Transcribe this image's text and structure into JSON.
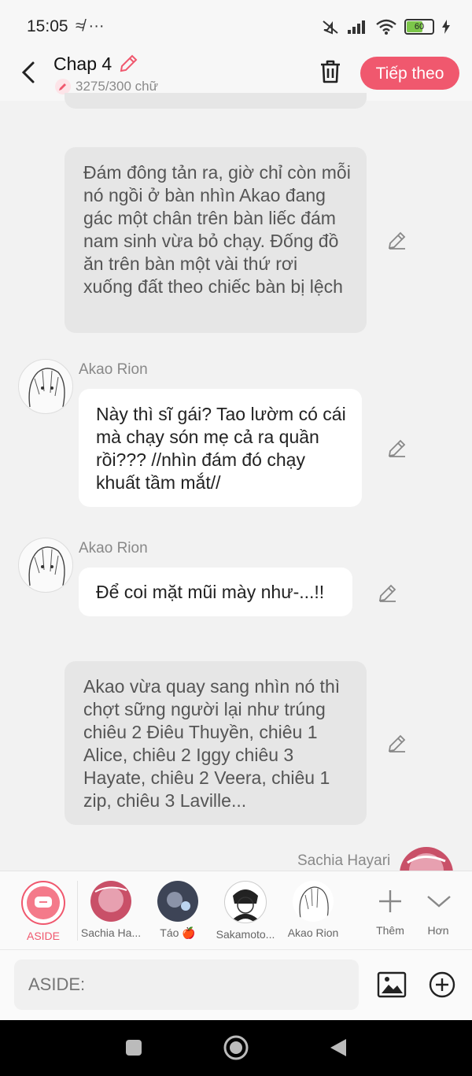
{
  "status": {
    "time": "15:05",
    "extra": "≉ ···",
    "battery": "60"
  },
  "header": {
    "title": "Chap 4",
    "word_count": "3275/300 chữ",
    "next_label": "Tiếp theo"
  },
  "messages": {
    "narr1": "Đám đông tản ra, giờ chỉ còn mỗi nó ngồi ở bàn nhìn Akao đang gác một chân trên bàn liếc đám nam sinh vừa bỏ chạy. Đống đồ ăn trên bàn một vài thứ rơi xuống đất theo chiếc bàn bị lệch",
    "m1_name": "Akao Rion",
    "m1_text": "Này thì sĩ gái? Tao lườm có cái mà chạy són mẹ cả ra quần rồi??? //nhìn đám đó chạy khuất tầm mắt//",
    "m2_name": "Akao Rion",
    "m2_text": "Để coi mặt mũi mày như-...!!",
    "narr2": "Akao vừa quay sang nhìn nó thì chợt sững người lại như trúng chiêu 2 Điêu Thuyền, chiêu 1 Alice, chiêu 2 Iggy chiêu 3 Hayate, chiêu 2 Veera, chiêu 1 zip, chiêu 3 Laville...",
    "m3_name": "Sachia Hayari"
  },
  "characters": [
    {
      "label": "ASIDE"
    },
    {
      "label": "Sachia Ha..."
    },
    {
      "label": "Táo 🍎"
    },
    {
      "label": "Sakamoto..."
    },
    {
      "label": "Akao Rion"
    },
    {
      "label": "Thêm"
    },
    {
      "label": "Hơn"
    }
  ],
  "input": {
    "placeholder": "ASIDE:"
  },
  "colors": {
    "accent": "#f0586e",
    "narration_bg": "#e6e6e6",
    "speech_bg": "#ffffff"
  }
}
